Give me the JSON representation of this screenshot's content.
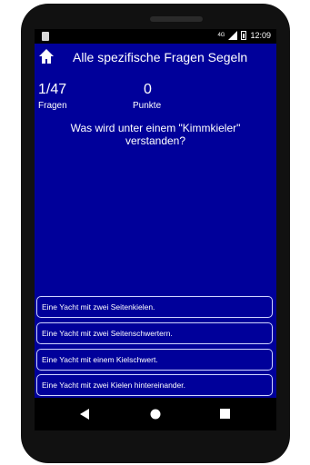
{
  "status_bar": {
    "network": "4G",
    "time": "12:09"
  },
  "app_bar": {
    "title": "Alle spezifische Fragen Segeln"
  },
  "stats": {
    "progress_value": "1/47",
    "progress_label": "Fragen",
    "points_value": "0",
    "points_label": "Punkte"
  },
  "question": {
    "text": "Was wird unter einem \"Kimmkieler\" verstanden?"
  },
  "answers": [
    {
      "label": "Eine Yacht mit zwei Seitenkielen."
    },
    {
      "label": "Eine Yacht mit zwei Seitenschwertern."
    },
    {
      "label": "Eine Yacht mit einem Kielschwert."
    },
    {
      "label": "Eine Yacht mit zwei Kielen hintereinander."
    }
  ],
  "colors": {
    "background": "#00009a",
    "text": "#ffffff",
    "answer_border": "#cfd4ff"
  }
}
